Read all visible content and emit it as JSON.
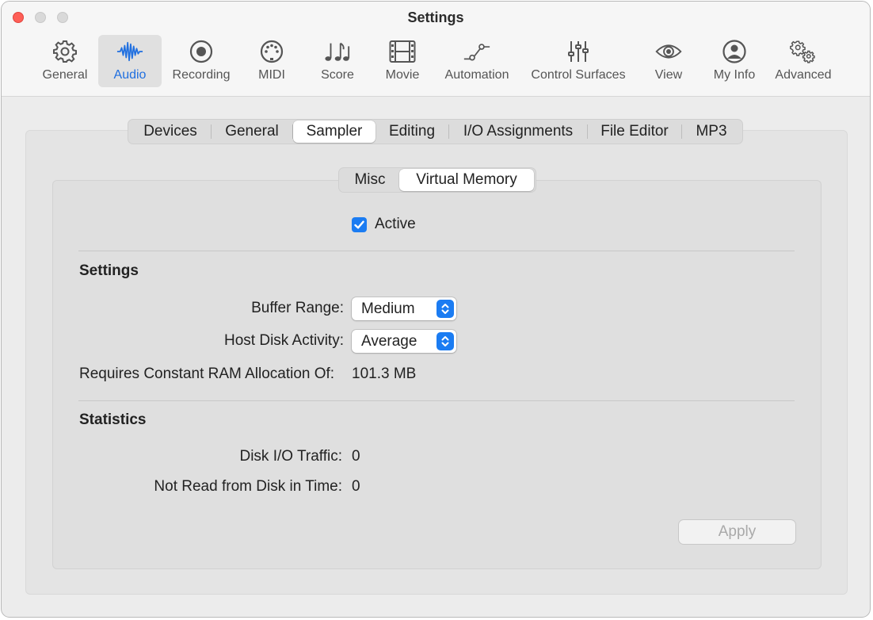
{
  "window": {
    "title": "Settings"
  },
  "toolbar": {
    "items": [
      {
        "label": "General",
        "icon": "gear-icon"
      },
      {
        "label": "Audio",
        "icon": "waveform-icon"
      },
      {
        "label": "Recording",
        "icon": "record-icon"
      },
      {
        "label": "MIDI",
        "icon": "midi-connector-icon"
      },
      {
        "label": "Score",
        "icon": "music-notes-icon"
      },
      {
        "label": "Movie",
        "icon": "film-strip-icon"
      },
      {
        "label": "Automation",
        "icon": "automation-curve-icon"
      },
      {
        "label": "Control Surfaces",
        "icon": "sliders-icon"
      },
      {
        "label": "View",
        "icon": "eye-icon"
      },
      {
        "label": "My Info",
        "icon": "person-circle-icon"
      },
      {
        "label": "Advanced",
        "icon": "gears-icon"
      }
    ],
    "selected": "Audio"
  },
  "tabs": {
    "items": [
      "Devices",
      "General",
      "Sampler",
      "Editing",
      "I/O Assignments",
      "File Editor",
      "MP3"
    ],
    "selected": "Sampler"
  },
  "subtabs": {
    "items": [
      "Misc",
      "Virtual Memory"
    ],
    "selected": "Virtual Memory"
  },
  "active": {
    "label": "Active",
    "checked": true
  },
  "settings": {
    "heading": "Settings",
    "buffer_range": {
      "label": "Buffer Range:",
      "value": "Medium"
    },
    "host_disk_activity": {
      "label": "Host Disk Activity:",
      "value": "Average"
    },
    "ram": {
      "label": "Requires Constant RAM Allocation Of:",
      "value": "101.3 MB"
    }
  },
  "statistics": {
    "heading": "Statistics",
    "disk_io": {
      "label": "Disk I/O Traffic:",
      "value": "0"
    },
    "not_read": {
      "label": "Not Read from Disk in Time:",
      "value": "0"
    }
  },
  "apply_label": "Apply",
  "colors": {
    "accent": "#1b7cf2",
    "selected_label": "#1f6fe0",
    "close": "#fe5f57"
  }
}
